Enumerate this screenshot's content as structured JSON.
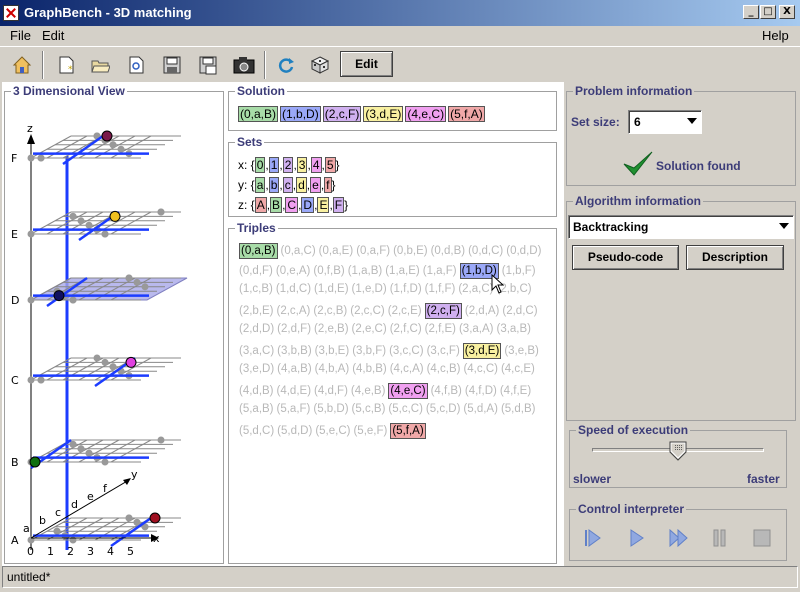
{
  "window": {
    "title": "GraphBench - 3D matching",
    "btn_min": "_",
    "btn_max": "□",
    "btn_close": "X"
  },
  "menu": {
    "file": "File",
    "edit": "Edit",
    "help": "Help"
  },
  "toolbar": {
    "icons": [
      "home-icon",
      "new-icon",
      "open-icon",
      "refresh-doc-icon",
      "save-icon",
      "save-as-icon",
      "camera-icon",
      "reload-icon",
      "dice-icon"
    ],
    "edit_label": "Edit"
  },
  "view3d": {
    "title": "3 Dimensional View",
    "z_axis": "z",
    "x_axis": "x",
    "y_axis": "y",
    "levels": [
      "F",
      "E",
      "D",
      "C",
      "B",
      "A"
    ],
    "x_ticks": [
      "0",
      "1",
      "2",
      "3",
      "4",
      "5"
    ],
    "y_ticks": [
      "a",
      "b",
      "c",
      "d",
      "e",
      "f"
    ]
  },
  "solution": {
    "title": "Solution",
    "items": [
      {
        "text": "(0,a,B)",
        "color": "green"
      },
      {
        "text": "(1,b,D)",
        "color": "blue"
      },
      {
        "text": "(2,c,F)",
        "color": "purple"
      },
      {
        "text": "(3,d,E)",
        "color": "yellow"
      },
      {
        "text": "(4,e,C)",
        "color": "pink"
      },
      {
        "text": "(5,f,A)",
        "color": "red"
      }
    ]
  },
  "sets": {
    "title": "Sets",
    "rows": [
      {
        "label": "x: {",
        "items": [
          {
            "t": "0",
            "c": "green"
          },
          {
            "t": "1",
            "c": "blue"
          },
          {
            "t": "2",
            "c": "purple"
          },
          {
            "t": "3",
            "c": "yellow"
          },
          {
            "t": "4",
            "c": "pink"
          },
          {
            "t": "5",
            "c": "red"
          }
        ],
        "close": "}"
      },
      {
        "label": "y: {",
        "items": [
          {
            "t": "a",
            "c": "green"
          },
          {
            "t": "b",
            "c": "blue"
          },
          {
            "t": "c",
            "c": "purple"
          },
          {
            "t": "d",
            "c": "yellow"
          },
          {
            "t": "e",
            "c": "pink"
          },
          {
            "t": "f",
            "c": "red"
          }
        ],
        "close": "}"
      },
      {
        "label": "z: {",
        "items": [
          {
            "t": "A",
            "c": "red"
          },
          {
            "t": "B",
            "c": "green"
          },
          {
            "t": "C",
            "c": "pink"
          },
          {
            "t": "D",
            "c": "blue"
          },
          {
            "t": "E",
            "c": "yellow"
          },
          {
            "t": "F",
            "c": "purple"
          }
        ],
        "close": "}"
      }
    ]
  },
  "triples": {
    "title": "Triples",
    "rows": [
      [
        "(0,a,B)*green",
        "(0,a,C)",
        "(0,a,E)",
        "(0,a,F)",
        "(0,b,E)",
        "(0,d,B)",
        "(0,d,C)",
        "(0,d,D)"
      ],
      [
        "(0,d,F)",
        "(0,e,A)",
        "(0,f,B)",
        "(1,a,B)",
        "(1,a,E)",
        "(1,a,F)",
        "(1,b,D)*blue",
        "(1,b,F)"
      ],
      [
        "(1,c,B)",
        "(1,d,C)",
        "(1,d,E)",
        "(1,e,D)",
        "(1,f,D)",
        "(1,f,F)",
        "(2,a,C)",
        "(2,b,C)"
      ],
      [
        "(2,b,E)",
        "(2,c,A)",
        "(2,c,B)",
        "(2,c,C)",
        "(2,c,E)",
        "(2,c,F)*purple",
        "(2,d,A)",
        "(2,d,C)"
      ],
      [
        "(2,d,D)",
        "(2,d,F)",
        "(2,e,B)",
        "(2,e,C)",
        "(2,f,C)",
        "(2,f,E)",
        "(3,a,A)",
        "(3,a,B)"
      ],
      [
        "(3,a,C)",
        "(3,b,B)",
        "(3,b,E)",
        "(3,b,F)",
        "(3,c,C)",
        "(3,c,F)",
        "(3,d,E)*yellow",
        "(3,e,B)"
      ],
      [
        "(3,e,D)",
        "(4,a,B)",
        "(4,b,A)",
        "(4,b,B)",
        "(4,c,A)",
        "(4,c,B)",
        "(4,c,C)",
        "(4,c,E)"
      ],
      [
        "(4,d,B)",
        "(4,d,E)",
        "(4,d,F)",
        "(4,e,B)",
        "(4,e,C)*pink",
        "(4,f,B)",
        "(4,f,D)",
        "(4,f,E)"
      ],
      [
        "(5,a,B)",
        "(5,a,F)",
        "(5,b,D)",
        "(5,c,B)",
        "(5,c,C)",
        "(5,c,D)",
        "(5,d,A)",
        "(5,d,B)"
      ],
      [
        "(5,d,C)",
        "(5,d,D)",
        "(5,e,C)",
        "(5,e,F)",
        "(5,f,A)*red"
      ]
    ]
  },
  "problem": {
    "title": "Problem information",
    "set_size_label": "Set size:",
    "set_size_value": "6",
    "status": "Solution found"
  },
  "algorithm": {
    "title": "Algorithm information",
    "selected": "Backtracking",
    "pseudo_code": "Pseudo-code",
    "description": "Description"
  },
  "speed": {
    "title": "Speed of execution",
    "slower": "slower",
    "faster": "faster",
    "value_fraction": 0.5
  },
  "control": {
    "title": "Control interpreter",
    "icons": [
      "step-icon",
      "play-icon",
      "fast-forward-icon",
      "pause-icon",
      "stop-icon"
    ]
  },
  "status_bar": "untitled*",
  "colors": {
    "green": "#a8dca8",
    "blue": "#9aa8f8",
    "purple": "#d0b0f0",
    "yellow": "#f8f0a0",
    "pink": "#f0a0f0",
    "red": "#f0a8a8"
  }
}
